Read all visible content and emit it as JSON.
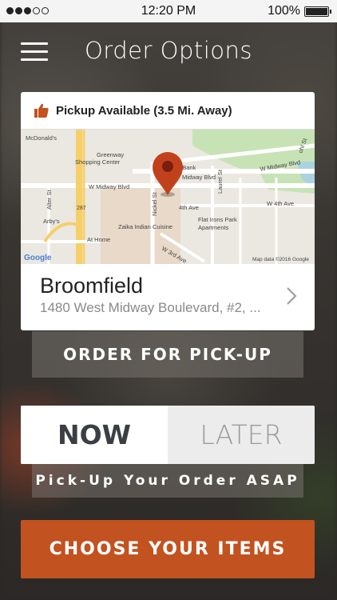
{
  "status_bar": {
    "time": "12:20 PM",
    "battery_percent": "100%",
    "signal_bars_filled": 3,
    "signal_bars_total": 5
  },
  "header": {
    "title": "Order Options",
    "menu_icon": "hamburger-menu-icon"
  },
  "location_card": {
    "availability_icon": "thumbs-up-icon",
    "availability_text": "Pickup Available (3.5 Mi. Away)",
    "map": {
      "labels": {
        "mcdonalds": "McDonald's",
        "greenway_1": "Greenway",
        "greenway_2": "Shopping Center",
        "bank": "o Bank",
        "midway_blvd_right": "W Midway Blvd",
        "midway_blvd_left": "W Midway Blvd",
        "midway_blvd_center": "Midway Blvd",
        "route": "287",
        "alter_st": "Alter St",
        "arbys": "Arby's",
        "nickel_st": "Nickel St",
        "laurel_st": "Laurel St",
        "fourth_ave": "4th Ave",
        "w_fourth_ave": "W 4th Ave",
        "zaika": "Zaika Indian Cuisine",
        "flat_irons_1": "Flat Irons Park",
        "flat_irons_2": "Apartments",
        "at_home": "At Home",
        "w_third_ave": "W 3rd Ave",
        "ohl_st": "ohl St",
        "google": "Google",
        "attribution": "Map data ©2016 Google"
      },
      "pin_icon": "map-pin-icon",
      "pin_color": "#c2411d"
    },
    "name": "Broomfield",
    "address": "1480 West Midway Boulevard, #2, ...",
    "chevron_icon": "chevron-right-icon"
  },
  "order_type_button": "ORDER FOR PICK-UP",
  "timing": {
    "now_label": "NOW",
    "later_label": "LATER",
    "selected": "NOW"
  },
  "timing_hint": "Pick-Up Your Order ASAP",
  "cta_button": "CHOOSE YOUR ITEMS",
  "colors": {
    "accent": "#c2521f",
    "card": "#ffffff",
    "overlay": "rgba(120,115,110,0.55)"
  }
}
